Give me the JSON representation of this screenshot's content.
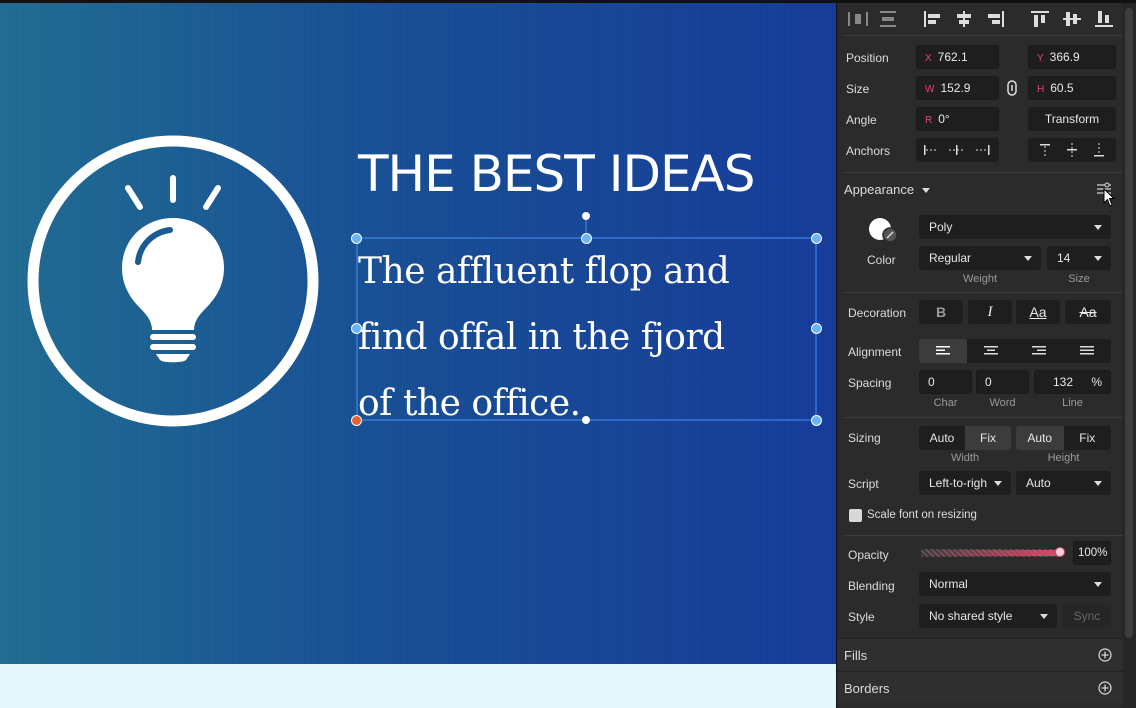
{
  "canvas": {
    "title": "THE BEST IDEAS",
    "body_lines": [
      "The affluent flop and",
      "find offal in the fjord",
      "of the office."
    ]
  },
  "inspector": {
    "position": {
      "label": "Position",
      "x_prefix": "X",
      "x": "762.1",
      "y_prefix": "Y",
      "y": "366.9"
    },
    "size": {
      "label": "Size",
      "w_prefix": "W",
      "w": "152.9",
      "h_prefix": "H",
      "h": "60.5"
    },
    "angle": {
      "label": "Angle",
      "r_prefix": "R",
      "r": "0°",
      "transform_button": "Transform"
    },
    "anchors": {
      "label": "Anchors"
    },
    "appearance": {
      "label": "Appearance"
    },
    "font": {
      "color_label": "Color",
      "family": "Poly",
      "weight": "Regular",
      "weight_label": "Weight",
      "size": "14",
      "size_label": "Size"
    },
    "decoration": {
      "label": "Decoration",
      "bold": "B",
      "italic": "I",
      "case": "Aa",
      "strike": "Aa"
    },
    "alignment": {
      "label": "Alignment"
    },
    "spacing": {
      "label": "Spacing",
      "char": "0",
      "word": "0",
      "line": "132",
      "line_unit": "%",
      "char_label": "Char",
      "word_label": "Word",
      "line_label": "Line"
    },
    "sizing": {
      "label": "Sizing",
      "width_auto": "Auto",
      "width_fix": "Fix",
      "height_auto": "Auto",
      "height_fix": "Fix",
      "width_label": "Width",
      "height_label": "Height"
    },
    "script": {
      "label": "Script",
      "direction": "Left-to-righ",
      "mode": "Auto"
    },
    "scale_font": {
      "label": "Scale font on resizing",
      "checked": false
    },
    "opacity": {
      "label": "Opacity",
      "value": "100%",
      "fraction": 1.0
    },
    "blending": {
      "label": "Blending",
      "value": "Normal"
    },
    "style": {
      "label": "Style",
      "value": "No shared style",
      "sync": "Sync"
    },
    "fills": {
      "label": "Fills"
    },
    "borders": {
      "label": "Borders"
    }
  },
  "colors": {
    "accent_handle": "#6bb3ff",
    "opacity_bar": "#e0486a",
    "bg_start": "#1f6b91",
    "bg_end": "#153b98"
  }
}
